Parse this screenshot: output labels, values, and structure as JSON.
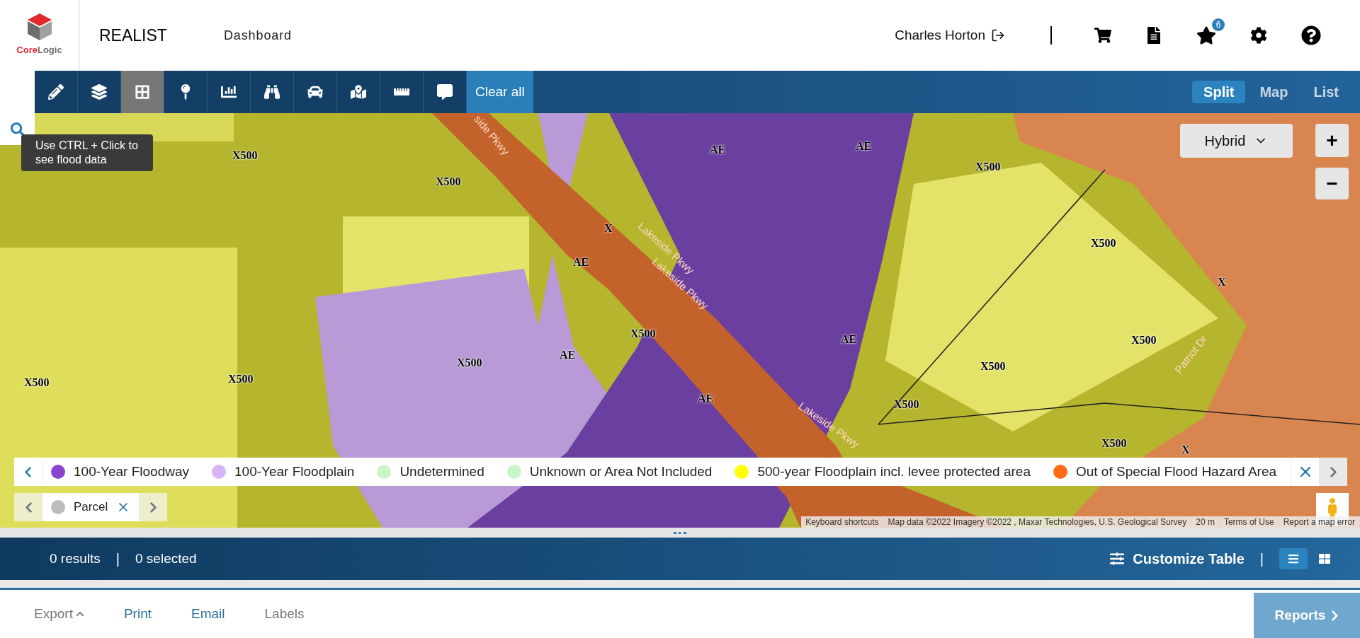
{
  "header": {
    "logo": {
      "parts": [
        {
          "text": "Core",
          "color": "#e0282e"
        },
        {
          "text": "Logic",
          "color": "#6d6d6d"
        }
      ]
    },
    "product": "REALIST",
    "nav": [
      {
        "label": "Dashboard"
      }
    ],
    "user": "Charles Horton",
    "favorites_count": "6"
  },
  "toolbar": {
    "tools": [
      {
        "kind": "draw",
        "selected": false
      },
      {
        "kind": "layers",
        "selected": false
      },
      {
        "kind": "grid",
        "selected": true
      },
      {
        "kind": "pin",
        "selected": false
      },
      {
        "kind": "chart",
        "selected": false
      },
      {
        "kind": "binoculars",
        "selected": false
      },
      {
        "kind": "car",
        "selected": false
      },
      {
        "kind": "map",
        "selected": false
      },
      {
        "kind": "ruler",
        "selected": false
      },
      {
        "kind": "comment",
        "selected": false
      }
    ],
    "clear_label": "Clear all",
    "view_tabs": [
      {
        "label": "Split",
        "selected": true
      },
      {
        "label": "Map",
        "selected": false
      },
      {
        "label": "List",
        "selected": false
      }
    ]
  },
  "map": {
    "tooltip": "Use CTRL + Click to see flood data",
    "map_type": "Hybrid",
    "zoom_in": "+",
    "zoom_out": "−",
    "labels": [
      {
        "kind": "zone",
        "text": "X500"
      },
      {
        "kind": "zone",
        "text": "X500"
      },
      {
        "kind": "zone",
        "text": "AE"
      },
      {
        "kind": "zone",
        "text": "AE"
      },
      {
        "kind": "zone",
        "text": "X500"
      },
      {
        "kind": "zone",
        "text": "X500"
      },
      {
        "kind": "zone",
        "text": "X"
      },
      {
        "kind": "zone",
        "text": "AE"
      },
      {
        "kind": "zone",
        "text": "X500"
      },
      {
        "kind": "zone",
        "text": "X500"
      },
      {
        "kind": "zone",
        "text": "X500"
      },
      {
        "kind": "zone",
        "text": "X500"
      },
      {
        "kind": "zone",
        "text": "AE"
      },
      {
        "kind": "zone",
        "text": "AE"
      },
      {
        "kind": "zone",
        "text": "X"
      },
      {
        "kind": "zone",
        "text": "X500"
      },
      {
        "kind": "zone",
        "text": "X500"
      },
      {
        "kind": "zone",
        "text": "X500"
      },
      {
        "kind": "zone",
        "text": "AE"
      },
      {
        "kind": "zone",
        "text": "X500"
      },
      {
        "kind": "zone",
        "text": "X"
      },
      {
        "kind": "street",
        "text": "side Pkwy"
      },
      {
        "kind": "street",
        "text": "Lakeside Pkwy"
      },
      {
        "kind": "street",
        "text": "Lakeside Pkwy"
      },
      {
        "kind": "street",
        "text": "Lakeside Pkwy"
      },
      {
        "kind": "street",
        "text": "Patriot Dr"
      }
    ],
    "legend": [
      {
        "label": "100-Year Floodway",
        "color": "#8a44cf"
      },
      {
        "label": "100-Year Floodplain",
        "color": "#d9b3f7"
      },
      {
        "label": "Undetermined",
        "color": "#c9f5cb"
      },
      {
        "label": "Unknown or Area Not Included",
        "color": "#c9f5cb"
      },
      {
        "label": "500-year Floodplain incl. levee protected area",
        "color": "#ffff00"
      },
      {
        "label": "Out of Special Flood Hazard Area",
        "color": "#ff6a13"
      }
    ],
    "parcel": {
      "label": "Parcel",
      "color": "#bdbdbd"
    },
    "attribution": [
      "Keyboard shortcuts",
      "Map data ©2022 Imagery ©2022 , Maxar Technologies, U.S. Geological Survey",
      "20 m",
      "Terms of Use",
      "Report a map error"
    ]
  },
  "results": {
    "count": "0 results",
    "dividers": [
      "|",
      "|"
    ],
    "selected": "0 selected",
    "customize": "Customize Table",
    "views": [
      {
        "kind": "list",
        "selected": true
      },
      {
        "kind": "grid",
        "selected": false
      }
    ]
  },
  "footer": {
    "actions": [
      {
        "label": "Export",
        "kind": "menu",
        "disabled": true
      },
      {
        "label": "Print",
        "kind": "link",
        "disabled": false
      },
      {
        "label": "Email",
        "kind": "link",
        "disabled": false
      },
      {
        "label": "Labels",
        "kind": "link",
        "disabled": true
      }
    ],
    "reports": "Reports"
  }
}
